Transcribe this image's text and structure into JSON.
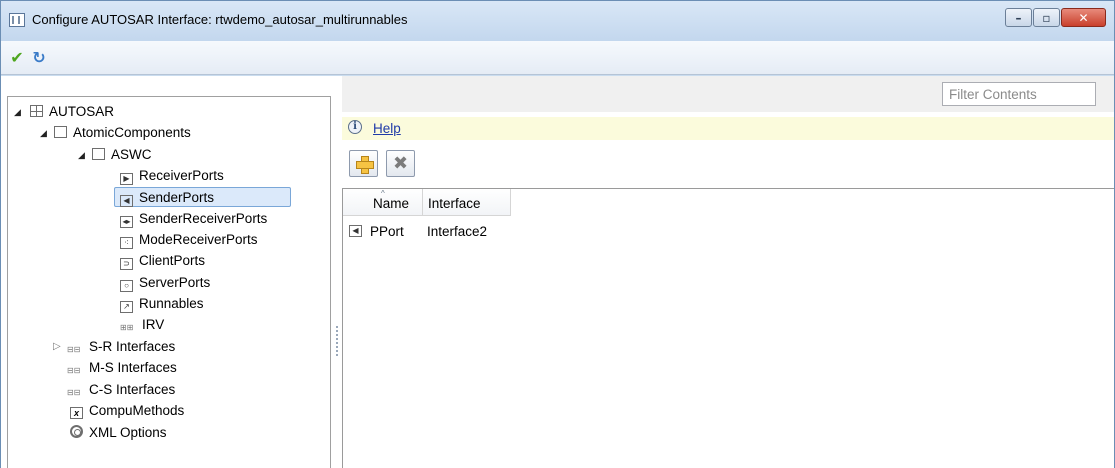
{
  "window": {
    "title": "Configure AUTOSAR Interface: rtwdemo_autosar_multirunnables",
    "minimize_glyph": "–",
    "maximize_glyph": "▫",
    "close_glyph": "✕"
  },
  "toolbar": {
    "apply_icon": "check-icon",
    "refresh_icon": "refresh-icon",
    "apply_glyph": "✔",
    "refresh_glyph": "↻"
  },
  "tree": {
    "root": "AUTOSAR",
    "atomic_components": "AtomicComponents",
    "component": "ASWC",
    "items": {
      "receiver_ports": "ReceiverPorts",
      "sender_ports": "SenderPorts",
      "sender_receiver_ports": "SenderReceiverPorts",
      "mode_receiver_ports": "ModeReceiverPorts",
      "client_ports": "ClientPorts",
      "server_ports": "ServerPorts",
      "runnables": "Runnables",
      "irv": "IRV"
    },
    "sr_interfaces": "S-R Interfaces",
    "ms_interfaces": "M-S Interfaces",
    "cs_interfaces": "C-S Interfaces",
    "compu_methods": "CompuMethods",
    "xml_options": "XML Options",
    "selected": "SenderPorts"
  },
  "right": {
    "filter_placeholder": "Filter Contents",
    "help_label": "Help",
    "columns": {
      "name": "Name",
      "interface": "Interface"
    },
    "rows": [
      {
        "name": "PPort",
        "interface": "Interface2"
      }
    ]
  },
  "colors": {
    "selection": "#dbe9fa",
    "help_bar": "#fbfbdc",
    "link": "#1f3aa8",
    "title_bg": "#c9dcef"
  }
}
